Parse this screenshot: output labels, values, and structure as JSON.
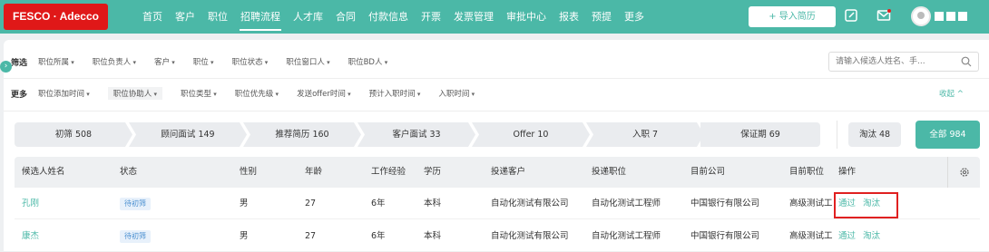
{
  "brand": {
    "logo": "FESCO · Adecco",
    "color": "#e01818",
    "accent": "#4bb8a7"
  },
  "nav": {
    "items": [
      "首页",
      "客户",
      "职位",
      "招聘流程",
      "人才库",
      "合同",
      "付款信息",
      "开票",
      "发票管理",
      "审批中心",
      "报表",
      "预提",
      "更多"
    ],
    "active": "招聘流程"
  },
  "toolbar": {
    "import_label": "+ 导入简历",
    "icons": [
      "edit-icon",
      "mail-icon"
    ]
  },
  "filters": {
    "row1_label": "筛选",
    "row1": [
      "职位所属",
      "职位负责人",
      "客户",
      "职位",
      "职位状态",
      "职位窗口人",
      "职位BD人"
    ],
    "row2_label": "更多",
    "row2": [
      "职位添加时间",
      "职位协助人",
      "职位类型",
      "职位优先级",
      "发送offer时间",
      "预计入职时间",
      "入职时间"
    ],
    "collapse_label": "收起 ^"
  },
  "search": {
    "placeholder": "请输入候选人姓名、手..."
  },
  "stages": [
    "初筛 508",
    "顾问面试 149",
    "推荐简历 160",
    "客户面试 33",
    "Offer 10",
    "入职 7",
    "保证期 69"
  ],
  "eliminated": "淘汰 48",
  "all": "全部 984",
  "table": {
    "headers": [
      "候选人姓名",
      "状态",
      "性别",
      "年龄",
      "工作经验",
      "学历",
      "投递客户",
      "投递职位",
      "目前公司",
      "目前职位",
      "操作"
    ],
    "rows": [
      {
        "name": "孔刚",
        "status": "待初筛",
        "gender": "男",
        "age": "27",
        "exp": "6年",
        "edu": "本科",
        "client": "自动化测试有限公司",
        "position": "自动化测试工程师",
        "company": "中国银行有限公司",
        "cur_pos": "高级测试工",
        "op_pass": "通过",
        "op_reject": "淘汰"
      },
      {
        "name": "康杰",
        "status": "待初筛",
        "gender": "男",
        "age": "27",
        "exp": "6年",
        "edu": "本科",
        "client": "自动化测试有限公司",
        "position": "自动化测试工程师",
        "company": "中国银行有限公司",
        "cur_pos": "高级测试工",
        "op_pass": "通过",
        "op_reject": "淘汰"
      }
    ]
  }
}
